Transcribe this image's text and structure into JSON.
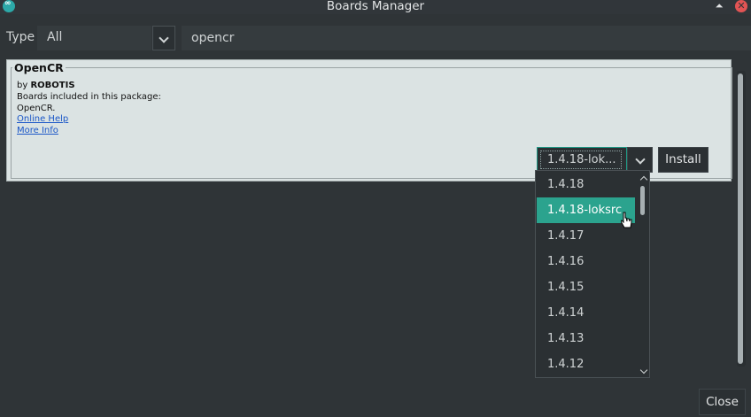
{
  "window": {
    "title": "Boards Manager",
    "app_icon": "infinity-icon",
    "maximize_icon": "maximize-icon",
    "close_icon": "close-icon"
  },
  "filter": {
    "type_label": "Type",
    "type_value": "All",
    "search_value": "opencr",
    "search_placeholder": ""
  },
  "board": {
    "name": "OpenCR",
    "by_prefix": "by",
    "author": "ROBOTIS",
    "boards_label": "Boards included in this package:",
    "boards": "OpenCR.",
    "online_help": "Online Help",
    "more_info": "More Info",
    "selected_version": "1.4.18-lok...",
    "install_label": "Install"
  },
  "version_list": {
    "items": [
      "1.4.18",
      "1.4.18-loksrc",
      "1.4.17",
      "1.4.16",
      "1.4.15",
      "1.4.14",
      "1.4.13",
      "1.4.12"
    ],
    "selected": "1.4.18-loksrc"
  },
  "footer": {
    "close_label": "Close"
  },
  "colors": {
    "accent": "#2ba38e",
    "background": "#2f3437",
    "card": "#dbe3e3",
    "link": "#1a56c7",
    "window_close": "#e25454"
  }
}
